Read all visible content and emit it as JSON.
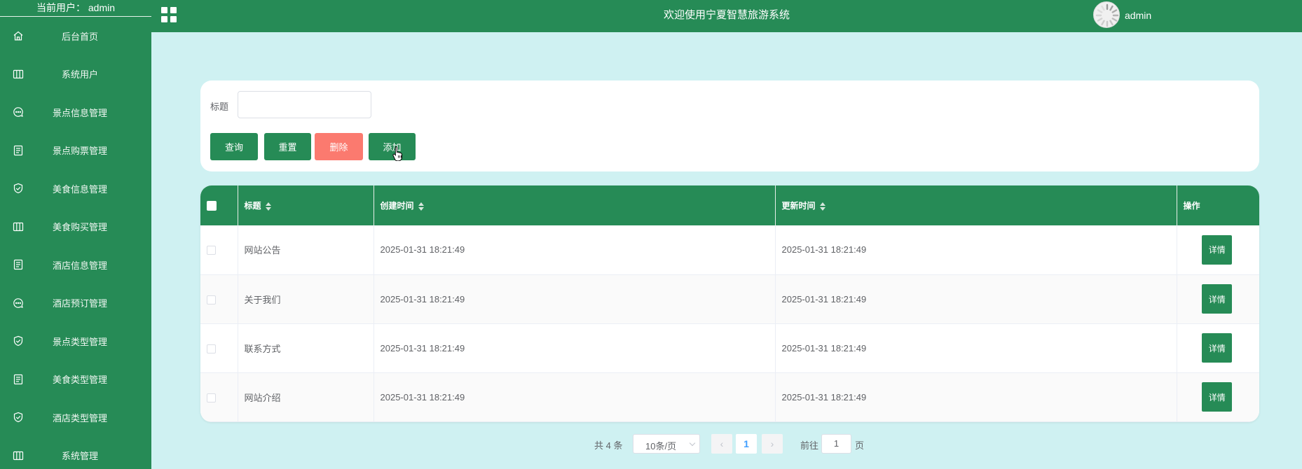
{
  "sidebar": {
    "current_user": "当前用户： admin",
    "items": [
      {
        "label": "后台首页",
        "icon": "home-icon"
      },
      {
        "label": "系统用户",
        "icon": "columns-icon"
      },
      {
        "label": "景点信息管理",
        "icon": "chat-icon"
      },
      {
        "label": "景点购票管理",
        "icon": "document-icon"
      },
      {
        "label": "美食信息管理",
        "icon": "shield-icon"
      },
      {
        "label": "美食购买管理",
        "icon": "columns-icon"
      },
      {
        "label": "酒店信息管理",
        "icon": "document-icon"
      },
      {
        "label": "酒店预订管理",
        "icon": "chat-icon"
      },
      {
        "label": "景点类型管理",
        "icon": "shield-icon"
      },
      {
        "label": "美食类型管理",
        "icon": "document-icon"
      },
      {
        "label": "酒店类型管理",
        "icon": "shield-icon"
      },
      {
        "label": "系统管理",
        "icon": "columns-icon"
      }
    ]
  },
  "header": {
    "title": "欢迎使用宁夏智慧旅游系统",
    "username": "admin"
  },
  "search": {
    "title_label": "标题",
    "title_value": "",
    "query_label": "查询",
    "reset_label": "重置",
    "delete_label": "删除",
    "add_label": "添加"
  },
  "table": {
    "columns": [
      "标题",
      "创建时间",
      "更新时间",
      "操作"
    ],
    "detail_label": "详情",
    "rows": [
      {
        "title": "网站公告",
        "created": "2025-01-31 18:21:49",
        "updated": "2025-01-31 18:21:49"
      },
      {
        "title": "关于我们",
        "created": "2025-01-31 18:21:49",
        "updated": "2025-01-31 18:21:49"
      },
      {
        "title": "联系方式",
        "created": "2025-01-31 18:21:49",
        "updated": "2025-01-31 18:21:49"
      },
      {
        "title": "网站介绍",
        "created": "2025-01-31 18:21:49",
        "updated": "2025-01-31 18:21:49"
      }
    ]
  },
  "pagination": {
    "total": "共 4 条",
    "page_size": "10条/页",
    "prev": "‹",
    "current_page": "1",
    "next": "›",
    "goto_label": "前往",
    "goto_value": "1",
    "goto_suffix": "页"
  },
  "colors": {
    "primary": "#268b56",
    "danger": "#fb7a6f",
    "background": "#cff1f2"
  }
}
